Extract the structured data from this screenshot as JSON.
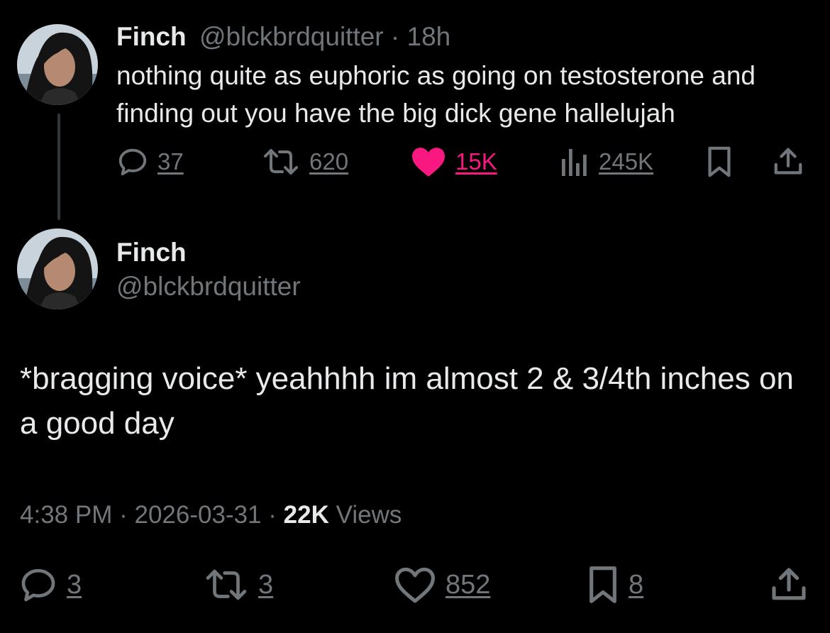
{
  "parent_tweet": {
    "display_name": "Finch",
    "handle": "@blckbrdquitter",
    "separator": "·",
    "time_ago": "18h",
    "text": "nothing quite as euphoric as going on testosterone and finding out you have the big dick gene hallelujah",
    "actions": {
      "replies": "37",
      "reposts": "620",
      "likes": "15K",
      "views": "245K"
    },
    "liked": true,
    "like_color": "#f91880",
    "icons": [
      "reply-icon",
      "repost-icon",
      "heart-filled-icon",
      "views-icon",
      "bookmark-icon",
      "share-icon"
    ]
  },
  "main_tweet": {
    "display_name": "Finch",
    "handle": "@blckbrdquitter",
    "text": "*bragging voice* yeahhhh im almost 2 & 3/4th inches on a good day",
    "time": "4:38 PM",
    "separator": "·",
    "date": "2026-03-31",
    "views_count": "22K",
    "views_label": "Views",
    "actions": {
      "replies": "3",
      "reposts": "3",
      "likes": "852",
      "bookmarks": "8"
    },
    "icons": [
      "reply-icon",
      "repost-icon",
      "heart-outline-icon",
      "bookmark-icon",
      "share-icon"
    ]
  },
  "theme": {
    "background": "#000000",
    "text_primary": "#e7e9ea",
    "text_secondary": "#71767b",
    "thread_line": "#333639"
  }
}
